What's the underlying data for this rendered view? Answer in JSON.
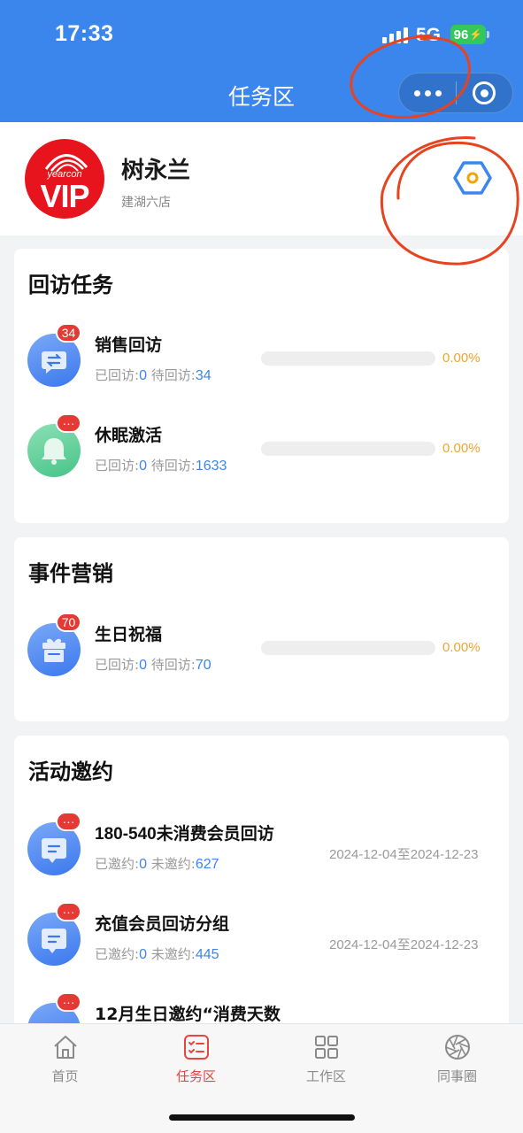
{
  "status_bar": {
    "time": "17:33",
    "network": "5G",
    "battery": "96"
  },
  "nav": {
    "title": "任务区"
  },
  "profile": {
    "name": "树永兰",
    "store": "建湖六店",
    "logo_brand": "yearcon",
    "logo_text": "VIP"
  },
  "sections": [
    {
      "title": "回访任务",
      "items": [
        {
          "name": "销售回访",
          "badge": "34",
          "icon": "exchange-chat-icon",
          "done_label": "已回访:",
          "done": "0",
          "pending_label": "待回访:",
          "pending": "34",
          "progress": 0,
          "percent": "0.00%"
        },
        {
          "name": "休眠激活",
          "badge": "···",
          "icon": "bell-icon",
          "done_label": "已回访:",
          "done": "0",
          "pending_label": "待回访:",
          "pending": "1633",
          "progress": 0,
          "percent": "0.00%"
        }
      ]
    },
    {
      "title": "事件营销",
      "items": [
        {
          "name": "生日祝福",
          "badge": "70",
          "icon": "gift-icon",
          "done_label": "已回访:",
          "done": "0",
          "pending_label": "待回访:",
          "pending": "70",
          "progress": 0,
          "percent": "0.00%"
        }
      ]
    },
    {
      "title": "活动邀约",
      "items": [
        {
          "name": "180-540未消费会员回访",
          "badge": "···",
          "icon": "message-icon",
          "done_label": "已邀约:",
          "done": "0",
          "pending_label": "未邀约:",
          "pending": "627",
          "date_range": "2024-12-04至2024-12-23"
        },
        {
          "name": "充值会员回访分组",
          "badge": "···",
          "icon": "message-icon",
          "done_label": "已邀约:",
          "done": "0",
          "pending_label": "未邀约:",
          "pending": "445",
          "date_range": "2024-12-04至2024-12-23"
        },
        {
          "name": "12月生日邀约“消费天数",
          "badge": "···",
          "icon": "message-icon"
        }
      ]
    }
  ],
  "tabbar": [
    {
      "label": "首页",
      "icon": "home-icon",
      "active": false
    },
    {
      "label": "任务区",
      "icon": "task-list-icon",
      "active": true
    },
    {
      "label": "工作区",
      "icon": "grid-icon",
      "active": false
    },
    {
      "label": "同事圈",
      "icon": "aperture-icon",
      "active": false
    }
  ],
  "colors": {
    "primary": "#3a86ec",
    "accent_red": "#e8453c",
    "badge": "#e53935",
    "percent": "#f0a52f",
    "annotation": "#e8431f"
  }
}
